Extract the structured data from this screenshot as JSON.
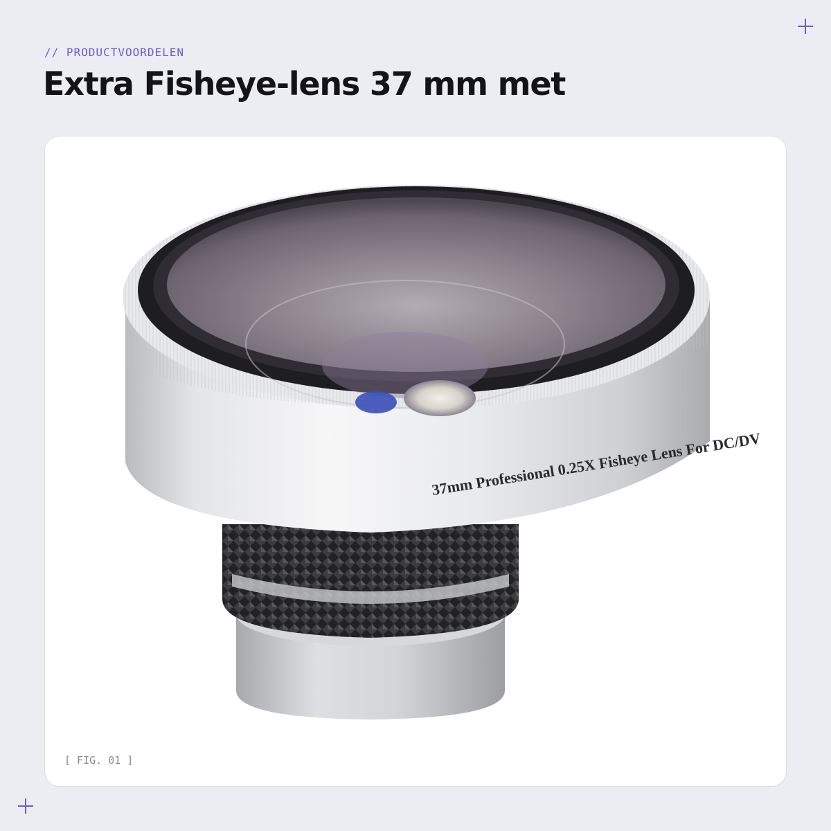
{
  "header": {
    "eyebrow": "// PRODUCTVOORDELEN",
    "title": "Extra Fisheye-lens 37 mm met"
  },
  "figure": {
    "lens_engraving": "37mm Professional 0.25X Fisheye Lens For DC/DV",
    "caption": "[ FIG. 01 ]"
  },
  "colors": {
    "accent": "#6a5bd6",
    "background": "#ecedf2",
    "title": "#141318",
    "card": "#ffffff"
  },
  "decorations": {
    "corner_marks": [
      "plus-icon",
      "plus-icon"
    ]
  }
}
